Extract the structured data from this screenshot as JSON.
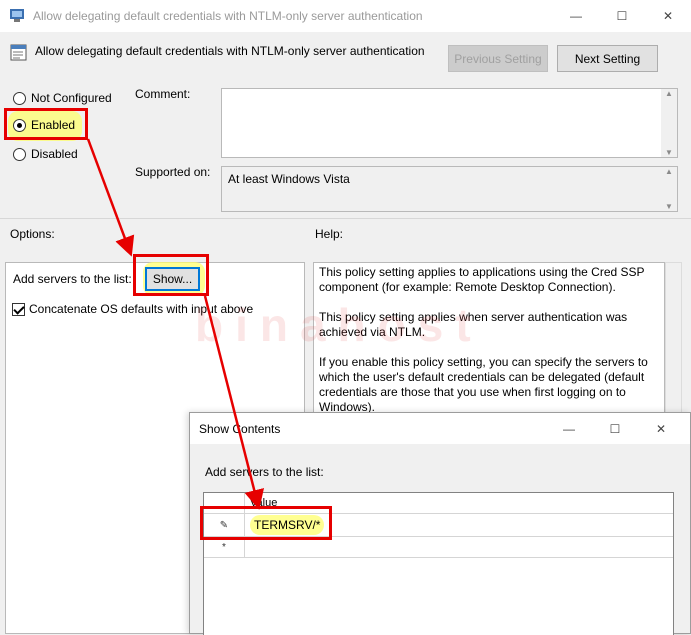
{
  "window": {
    "title": "Allow delegating default credentials with NTLM-only server authentication",
    "minimize_glyph": "—",
    "maximize_glyph": "☐",
    "close_glyph": "✕"
  },
  "header": {
    "title": "Allow delegating default credentials with NTLM-only server authentication",
    "prev_label": "Previous Setting",
    "next_label": "Next Setting"
  },
  "state": {
    "options": [
      "Not Configured",
      "Enabled",
      "Disabled"
    ],
    "selected": "Enabled"
  },
  "comment": {
    "label": "Comment:",
    "value": ""
  },
  "supported": {
    "label": "Supported on:",
    "value": "At least Windows Vista"
  },
  "options": {
    "label": "Options:",
    "add_servers_label": "Add servers to the list:",
    "show_button": "Show...",
    "concatenate_label": "Concatenate OS defaults with input above",
    "concatenate_checked": true
  },
  "help": {
    "label": "Help:",
    "paragraphs": [
      "This policy setting applies to applications using the Cred SSP component (for example: Remote Desktop Connection).",
      "This policy setting applies when server authentication was achieved via NTLM.",
      "If you enable this policy setting, you can specify the servers to which the user's default credentials can be delegated (default credentials are those that you use when first logging on to Windows)."
    ]
  },
  "show_contents": {
    "title": "Show Contents",
    "add_servers_label": "Add servers to the list:",
    "column_header": "Value",
    "rows": [
      {
        "marker": "✎",
        "value": "TERMSRV/*"
      },
      {
        "marker": "*",
        "value": ""
      }
    ]
  },
  "watermark": "binahost",
  "colors": {
    "annotation_red": "#e60000",
    "highlight_yellow": "#ffff6e",
    "focus_blue": "#0078d7"
  }
}
